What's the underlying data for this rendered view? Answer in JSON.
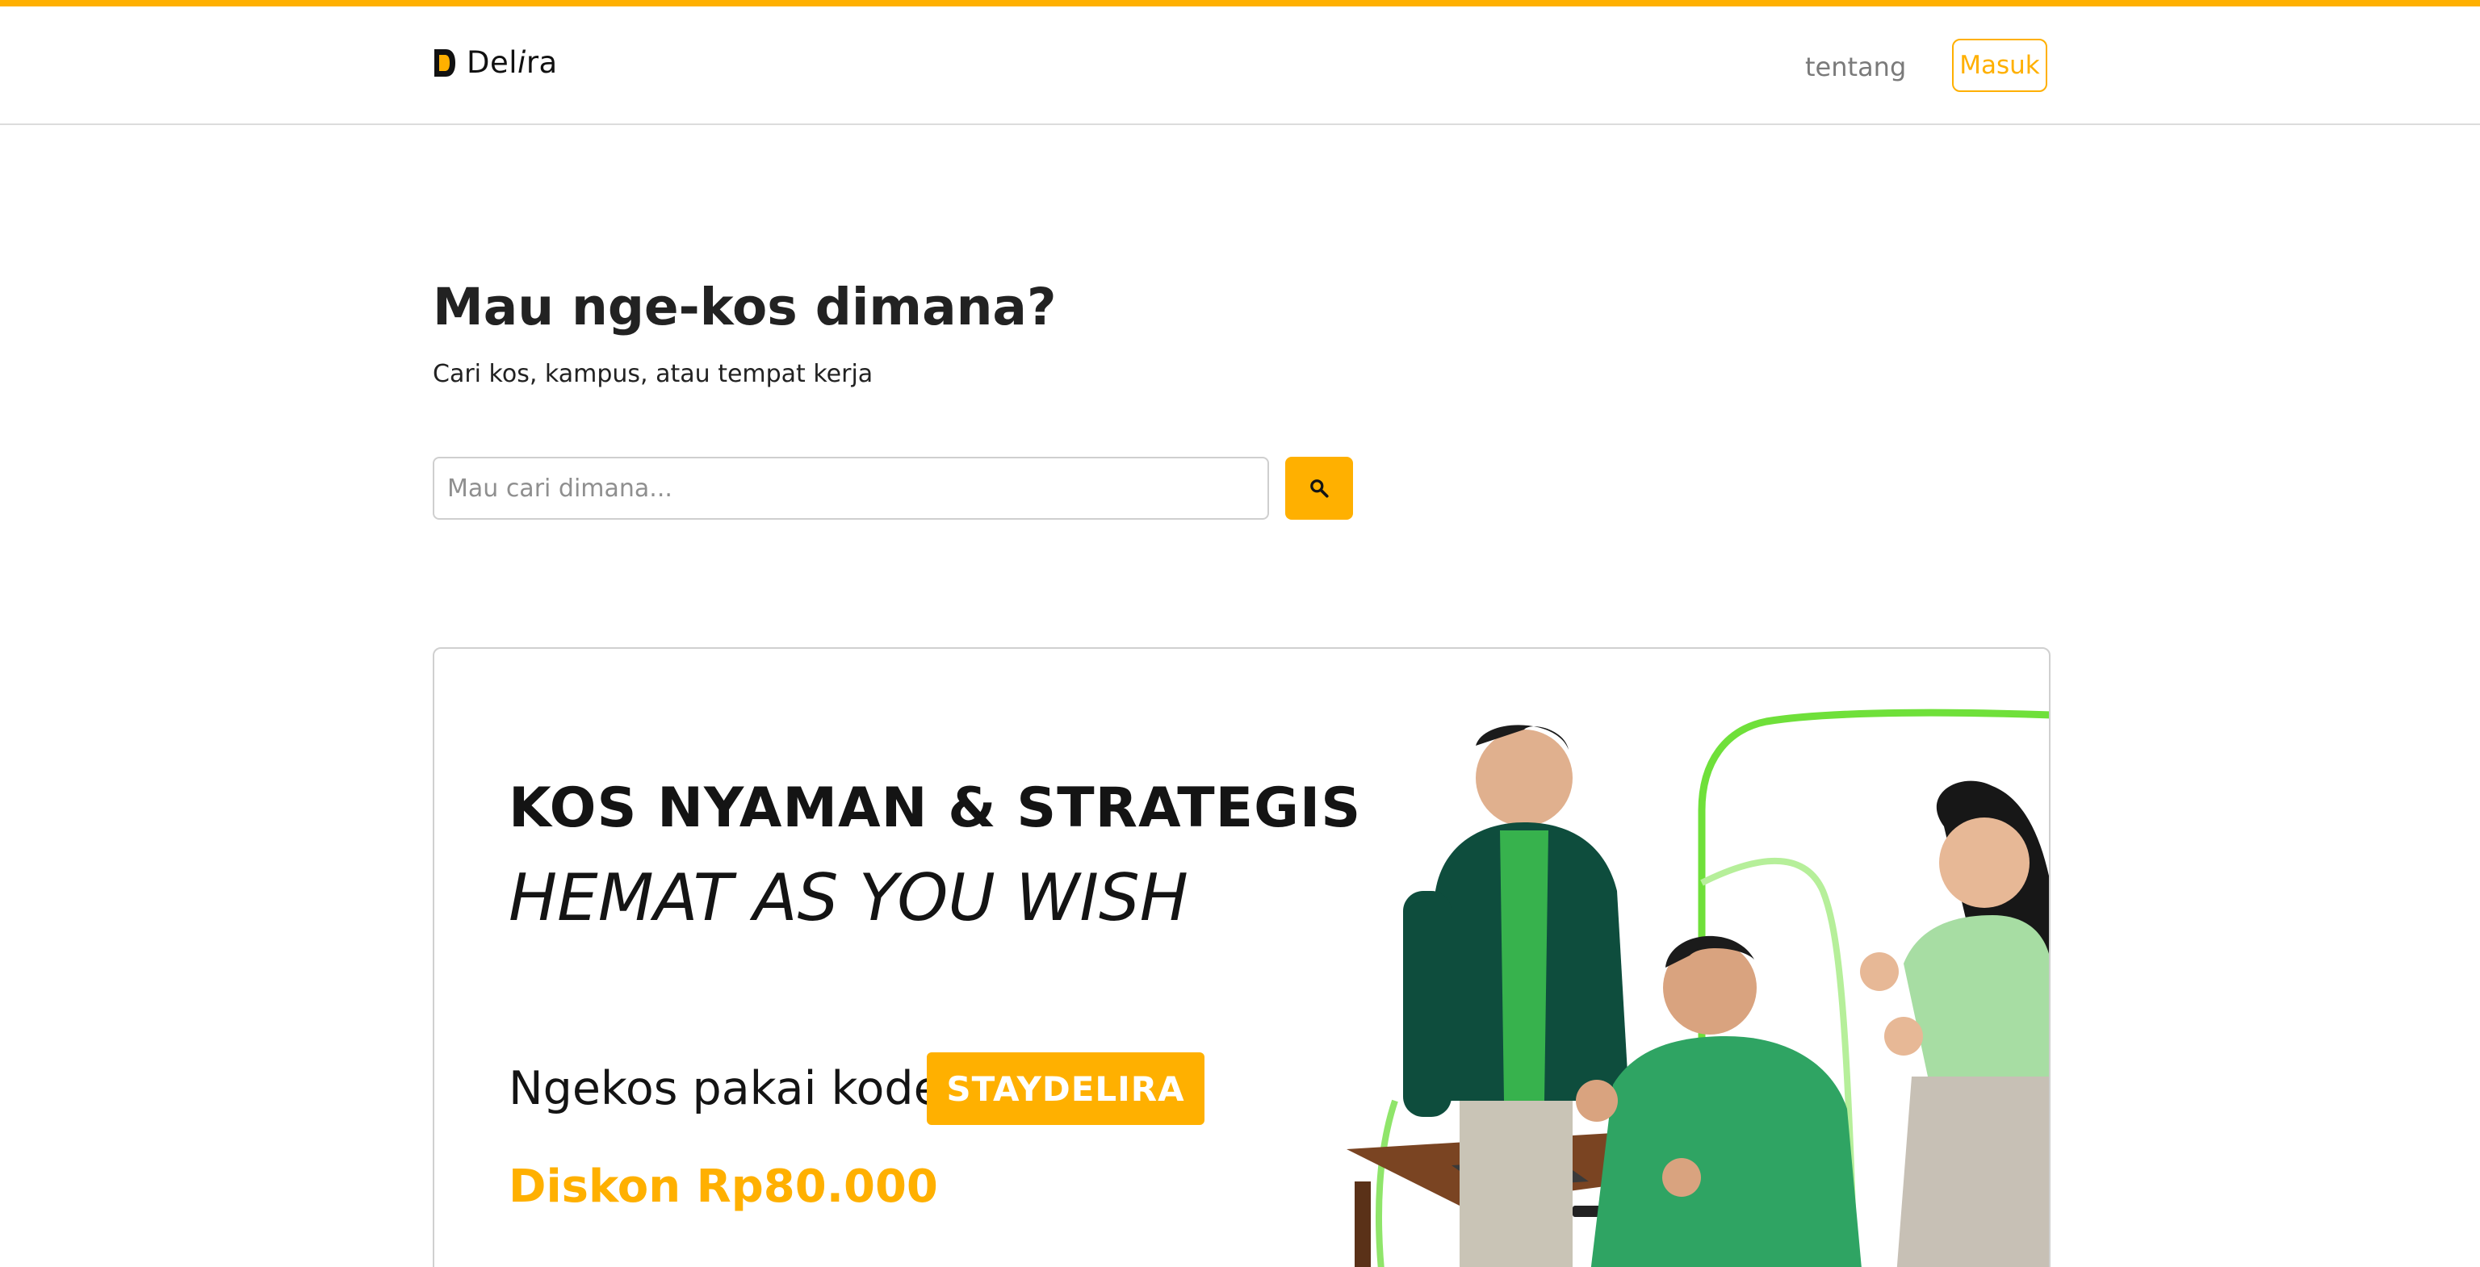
{
  "colors": {
    "accent": "#ffb000",
    "text": "#212121",
    "muted": "#7a7a7a"
  },
  "navbar": {
    "brand_prefix": "Del",
    "brand_italic": "i",
    "brand_suffix": "ra",
    "about_label": "tentang",
    "login_label": "Masuk"
  },
  "hero": {
    "title": "Mau nge-kos dimana?",
    "subtitle": "Cari kos, kampus, atau tempat kerja"
  },
  "search": {
    "placeholder": "Mau cari dimana...",
    "value": "",
    "button_icon": "search-icon"
  },
  "banner": {
    "headline": "KOS NYAMAN & STRATEGIS",
    "tagline": "HEMAT AS YOU WISH",
    "promo_text": "Ngekos pakai kode",
    "promo_code": "STAYDELIRA",
    "discount": "Diskon Rp80.000",
    "illustration": "people-celebrating-illustration"
  }
}
